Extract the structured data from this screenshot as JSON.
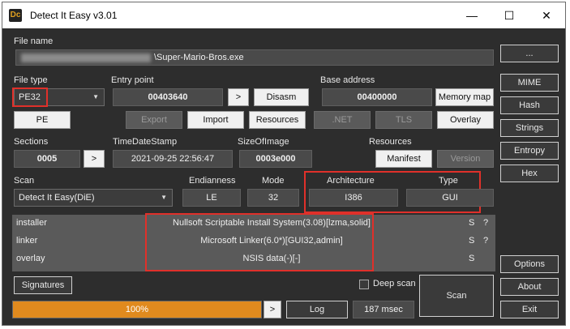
{
  "window": {
    "title": "Detect It Easy v3.01",
    "minimize": "—",
    "maximize": "☐",
    "close": "✕"
  },
  "file": {
    "label": "File name",
    "path": "\\Super-Mario-Bros.exe",
    "browse": "..."
  },
  "file_type": {
    "label": "File type",
    "value": "PE32"
  },
  "entry_point": {
    "label": "Entry point",
    "value": "00403640",
    "go": ">",
    "disasm": "Disasm"
  },
  "base_address": {
    "label": "Base address",
    "value": "00400000",
    "memory_map": "Memory map"
  },
  "buttons_row": {
    "pe": "PE",
    "export": "Export",
    "import": "Import",
    "resources": "Resources",
    "net": ".NET",
    "tls": "TLS",
    "overlay": "Overlay"
  },
  "sections": {
    "label": "Sections",
    "value": "0005",
    "go": ">"
  },
  "timedatestamp": {
    "label": "TimeDateStamp",
    "value": "2021-09-25 22:56:47"
  },
  "sizeofimage": {
    "label": "SizeOfImage",
    "value": "0003e000"
  },
  "resources_box": {
    "label": "Resources",
    "manifest": "Manifest",
    "version": "Version"
  },
  "scan": {
    "label": "Scan",
    "engine": "Detect It Easy(DiE)"
  },
  "endianness": {
    "label": "Endianness",
    "value": "LE"
  },
  "mode": {
    "label": "Mode",
    "value": "32"
  },
  "architecture": {
    "label": "Architecture",
    "value": "I386"
  },
  "type": {
    "label": "Type",
    "value": "GUI"
  },
  "results": [
    {
      "name": "installer",
      "value": "Nullsoft Scriptable Install System(3.08)[lzma,solid]",
      "s": "S",
      "q": "?"
    },
    {
      "name": "linker",
      "value": "Microsoft Linker(6.0*)[GUI32,admin]",
      "s": "S",
      "q": "?"
    },
    {
      "name": "overlay",
      "value": "NSIS data(-)[-]",
      "s": "S",
      "q": ""
    }
  ],
  "side": {
    "mime": "MIME",
    "hash": "Hash",
    "strings": "Strings",
    "entropy": "Entropy",
    "hex": "Hex",
    "options": "Options",
    "about": "About",
    "exit": "Exit"
  },
  "bottom": {
    "signatures": "Signatures",
    "deep_scan": "Deep scan",
    "scan_button": "Scan",
    "progress_text": "100%",
    "progress": 1.0,
    "go": ">",
    "log": "Log",
    "time": "187 msec"
  }
}
